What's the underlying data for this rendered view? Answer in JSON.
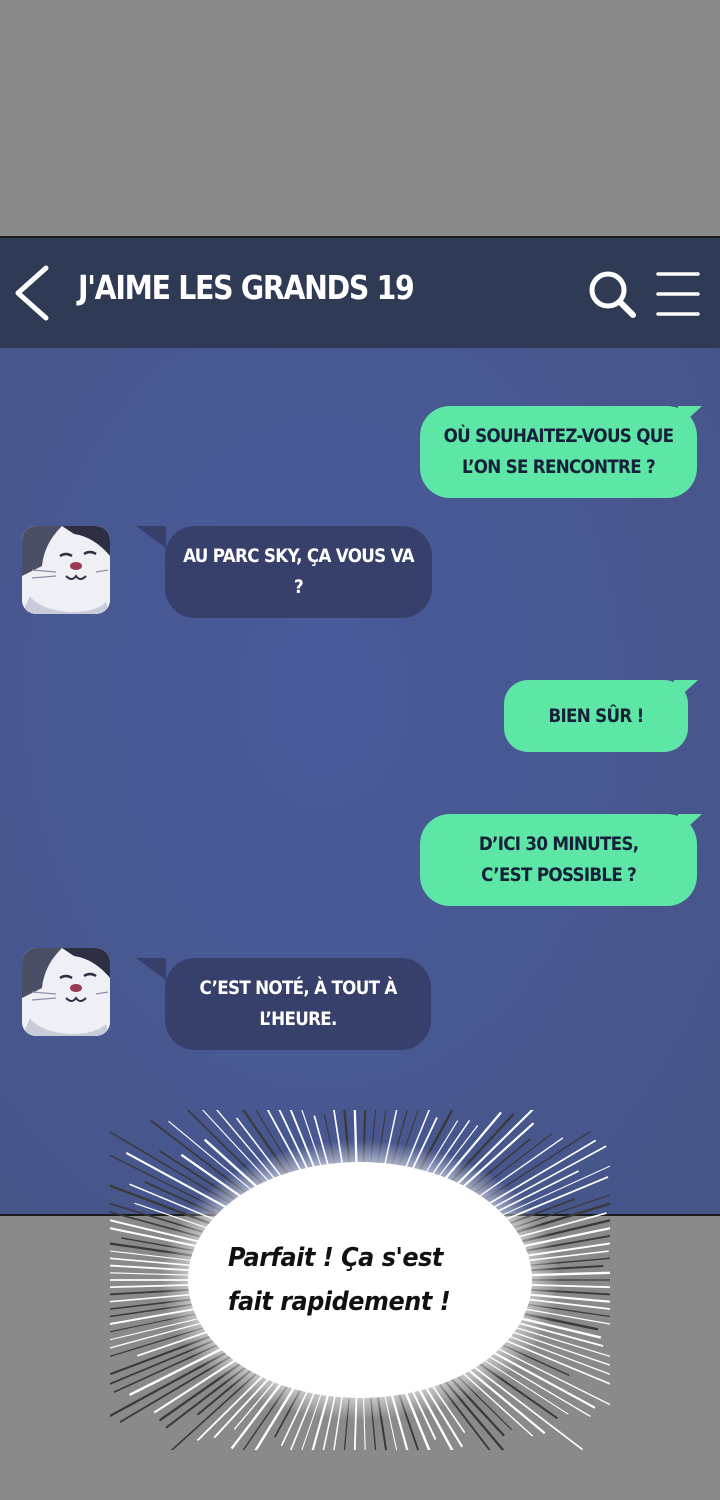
{
  "header": {
    "title": "J'AIME LES GRANDS 19",
    "back_icon": "chevron-left-icon",
    "search_icon": "search-icon",
    "menu_icon": "hamburger-menu-icon"
  },
  "messages": [
    {
      "side": "out",
      "text": "OÙ SOUHAITEZ-VOUS QUE\nL’ON SE RENCONTRE ?"
    },
    {
      "side": "in",
      "text": "AU PARC SKY, ÇA VOUS VA ?"
    },
    {
      "side": "out",
      "text": "BIEN SÛR !"
    },
    {
      "side": "out",
      "text": "D’ICI 30 MINUTES,\nC’EST POSSIBLE ?"
    },
    {
      "side": "in",
      "text": "C’EST NOTÉ, À TOUT À\nL’HEURE."
    }
  ],
  "narration": {
    "text": "Parfait ! Ça s'est\nfait rapidement !"
  },
  "colors": {
    "header": "#2f3a55",
    "chat_background": "#485892",
    "outgoing_bubble": "#5de6a5",
    "incoming_bubble": "#36406a",
    "page_background": "#8a8a8a"
  }
}
